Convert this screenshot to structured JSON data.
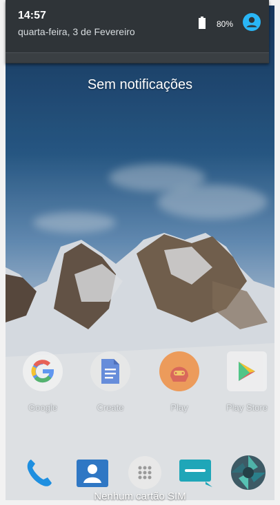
{
  "status": {
    "time": "14:57",
    "date": "quarta-feira, 3 de Fevereiro",
    "battery_percent": "80%",
    "battery_icon": "battery-icon",
    "account_icon": "account-circle-icon",
    "accent_color": "#29b6f6"
  },
  "notifications": {
    "empty_text": "Sem notificações"
  },
  "home_apps": [
    {
      "label": "Google",
      "icon": "google-icon"
    },
    {
      "label": "Create",
      "icon": "docs-create-icon"
    },
    {
      "label": "Play",
      "icon": "play-games-icon"
    },
    {
      "label": "Play Store",
      "icon": "play-store-icon"
    }
  ],
  "dock": [
    {
      "icon": "phone-icon"
    },
    {
      "icon": "contacts-icon"
    },
    {
      "icon": "app-drawer-icon"
    },
    {
      "icon": "messages-icon"
    },
    {
      "icon": "camera-icon"
    }
  ],
  "sim_status": "Nenhum cartão SIM"
}
